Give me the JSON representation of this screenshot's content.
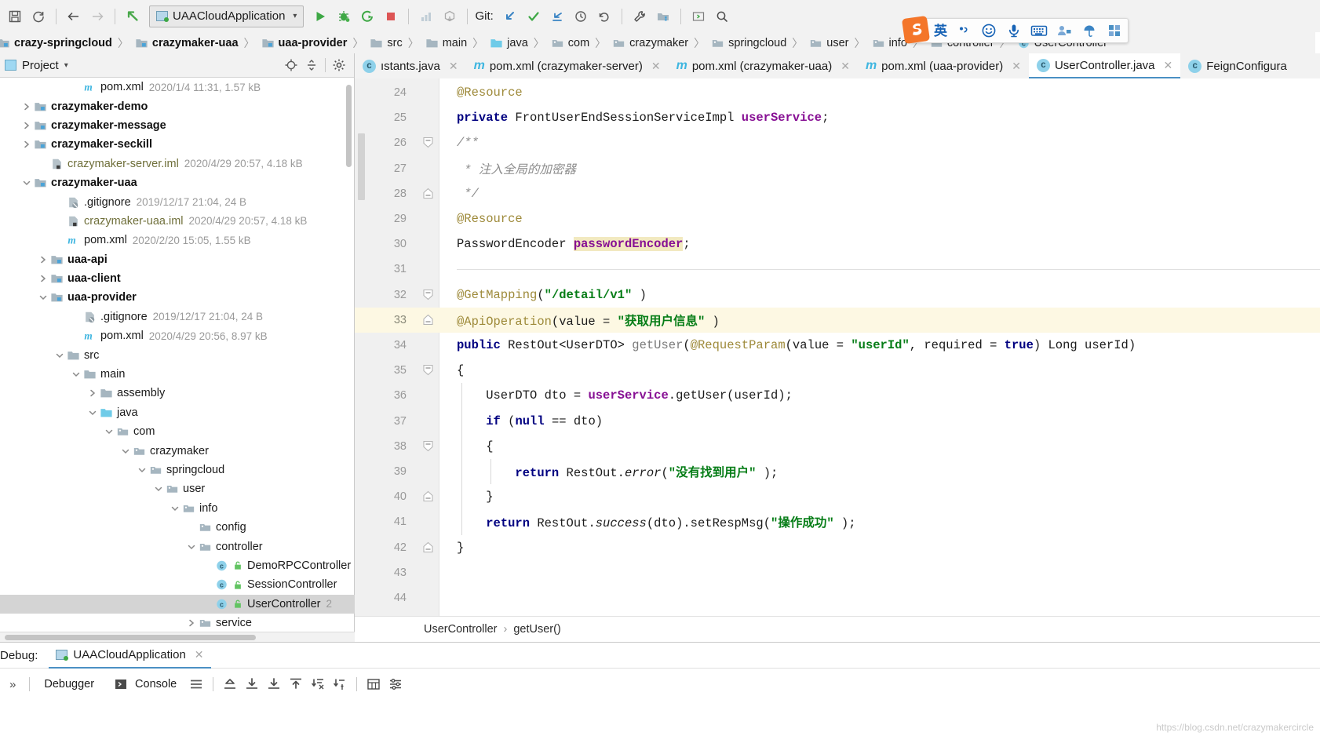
{
  "toolbar": {
    "icons": [
      {
        "name": "save-all-icon",
        "title": "Save All"
      },
      {
        "name": "sync-refresh-icon",
        "title": "Synchronize"
      },
      {
        "name": "back-arrow-icon",
        "title": "Back"
      },
      {
        "name": "forward-arrow-icon",
        "title": "Forward"
      },
      {
        "name": "jump-to-source-icon",
        "title": "Jump to source"
      }
    ],
    "run_config": {
      "label": "UAACloudApplication",
      "caret": "▾"
    },
    "run_icons": [
      {
        "name": "run-icon",
        "title": "Run"
      },
      {
        "name": "debug-icon",
        "title": "Debug"
      },
      {
        "name": "run-coverage-icon",
        "title": "Run with Coverage"
      },
      {
        "name": "stop-icon",
        "title": "Stop"
      },
      {
        "name": "profiler-icon",
        "title": "Profiler"
      },
      {
        "name": "update-app-icon",
        "title": "Update application"
      }
    ],
    "git_label": "Git:",
    "git_icons": [
      {
        "name": "git-update-project-icon",
        "title": "Update Project"
      },
      {
        "name": "git-commit-icon",
        "title": "Commit"
      },
      {
        "name": "git-push-icon",
        "title": "Push"
      },
      {
        "name": "git-history-icon",
        "title": "Show History"
      },
      {
        "name": "git-rollback-icon",
        "title": "Rollback"
      }
    ],
    "right_icons": [
      {
        "name": "settings-wrench-icon",
        "title": "Settings"
      },
      {
        "name": "project-structure-icon",
        "title": "Project Structure"
      },
      {
        "name": "terminal-icon",
        "title": "Terminal"
      },
      {
        "name": "search-everywhere-icon",
        "title": "Search Everywhere"
      }
    ]
  },
  "breadcrumb": {
    "separator": "〉",
    "items": [
      {
        "label": "crazy-springcloud",
        "icon": "module-icon",
        "bold": true
      },
      {
        "label": "crazymaker-uaa",
        "icon": "module-icon",
        "bold": true
      },
      {
        "label": "uaa-provider",
        "icon": "module-icon",
        "bold": true
      },
      {
        "label": "src",
        "icon": "folder-icon",
        "bold": false
      },
      {
        "label": "main",
        "icon": "folder-icon",
        "bold": false
      },
      {
        "label": "java",
        "icon": "source-folder-icon",
        "bold": false
      },
      {
        "label": "com",
        "icon": "package-icon",
        "bold": false
      },
      {
        "label": "crazymaker",
        "icon": "package-icon",
        "bold": false
      },
      {
        "label": "springcloud",
        "icon": "package-icon",
        "bold": false
      },
      {
        "label": "user",
        "icon": "package-icon",
        "bold": false
      },
      {
        "label": "info",
        "icon": "package-icon",
        "bold": false
      },
      {
        "label": "controller",
        "icon": "package-icon",
        "bold": false
      },
      {
        "label": "UserController",
        "icon": "class-icon",
        "bold": false
      }
    ]
  },
  "ime": {
    "logo": "S",
    "mode_label": "英",
    "items": [
      {
        "name": "sogou-logo-icon"
      },
      {
        "name": "ime-mode-english-icon"
      },
      {
        "name": "ime-punctuation-icon"
      },
      {
        "name": "ime-emoji-icon"
      },
      {
        "name": "ime-voice-icon"
      },
      {
        "name": "ime-keyboard-icon"
      },
      {
        "name": "ime-toolbox-icon"
      },
      {
        "name": "ime-umbrella-icon"
      },
      {
        "name": "ime-apps-icon"
      }
    ]
  },
  "project_panel": {
    "title": "Project",
    "title_caret": "▾",
    "actions": [
      {
        "name": "locate-target-icon",
        "title": "Select Opened File"
      },
      {
        "name": "collapse-all-icon",
        "title": "Collapse All"
      },
      {
        "name": "panel-settings-icon",
        "title": "Settings"
      }
    ],
    "tree": [
      {
        "indent": 4,
        "arrow": "none",
        "icon": "maven-pom-icon",
        "name": "pom.xml",
        "style": "plain",
        "meta": "2020/1/4 11:31, 1.57 kB"
      },
      {
        "indent": 1,
        "arrow": "right",
        "icon": "module-icon",
        "name": "crazymaker-demo",
        "style": "bold",
        "meta": ""
      },
      {
        "indent": 1,
        "arrow": "right",
        "icon": "module-icon",
        "name": "crazymaker-message",
        "style": "bold",
        "meta": ""
      },
      {
        "indent": 1,
        "arrow": "right",
        "icon": "module-icon",
        "name": "crazymaker-seckill",
        "style": "bold",
        "meta": ""
      },
      {
        "indent": 2,
        "arrow": "none",
        "icon": "iml-file-icon",
        "name": "crazymaker-server.iml",
        "style": "iml",
        "meta": "2020/4/29 20:57, 4.18 kB"
      },
      {
        "indent": 1,
        "arrow": "down",
        "icon": "module-icon",
        "name": "crazymaker-uaa",
        "style": "bold",
        "meta": ""
      },
      {
        "indent": 3,
        "arrow": "none",
        "icon": "gitignore-icon",
        "name": ".gitignore",
        "style": "plain",
        "meta": "2019/12/17 21:04, 24 B"
      },
      {
        "indent": 3,
        "arrow": "none",
        "icon": "iml-file-icon",
        "name": "crazymaker-uaa.iml",
        "style": "iml",
        "meta": "2020/4/29 20:57, 4.18 kB"
      },
      {
        "indent": 3,
        "arrow": "none",
        "icon": "maven-pom-icon",
        "name": "pom.xml",
        "style": "plain",
        "meta": "2020/2/20 15:05, 1.55 kB"
      },
      {
        "indent": 2,
        "arrow": "right",
        "icon": "module-icon",
        "name": "uaa-api",
        "style": "bold",
        "meta": ""
      },
      {
        "indent": 2,
        "arrow": "right",
        "icon": "module-icon",
        "name": "uaa-client",
        "style": "bold",
        "meta": ""
      },
      {
        "indent": 2,
        "arrow": "down",
        "icon": "module-icon",
        "name": "uaa-provider",
        "style": "bold",
        "meta": ""
      },
      {
        "indent": 4,
        "arrow": "none",
        "icon": "gitignore-icon",
        "name": ".gitignore",
        "style": "plain",
        "meta": "2019/12/17 21:04, 24 B"
      },
      {
        "indent": 4,
        "arrow": "none",
        "icon": "maven-pom-icon",
        "name": "pom.xml",
        "style": "plain",
        "meta": "2020/4/29 20:56, 8.97 kB"
      },
      {
        "indent": 3,
        "arrow": "down",
        "icon": "folder-icon",
        "name": "src",
        "style": "plain",
        "meta": ""
      },
      {
        "indent": 4,
        "arrow": "down",
        "icon": "folder-icon",
        "name": "main",
        "style": "plain",
        "meta": ""
      },
      {
        "indent": 5,
        "arrow": "right",
        "icon": "folder-icon",
        "name": "assembly",
        "style": "plain",
        "meta": ""
      },
      {
        "indent": 5,
        "arrow": "down",
        "icon": "source-folder-icon",
        "name": "java",
        "style": "plain",
        "meta": ""
      },
      {
        "indent": 6,
        "arrow": "down",
        "icon": "package-icon",
        "name": "com",
        "style": "plain",
        "meta": ""
      },
      {
        "indent": 7,
        "arrow": "down",
        "icon": "package-icon",
        "name": "crazymaker",
        "style": "plain",
        "meta": ""
      },
      {
        "indent": 8,
        "arrow": "down",
        "icon": "package-icon",
        "name": "springcloud",
        "style": "plain",
        "meta": ""
      },
      {
        "indent": 9,
        "arrow": "down",
        "icon": "package-icon",
        "name": "user",
        "style": "plain",
        "meta": ""
      },
      {
        "indent": 10,
        "arrow": "down",
        "icon": "package-icon",
        "name": "info",
        "style": "plain",
        "meta": ""
      },
      {
        "indent": 11,
        "arrow": "none",
        "icon": "package-icon",
        "name": "config",
        "style": "plain",
        "meta": ""
      },
      {
        "indent": 11,
        "arrow": "down",
        "icon": "package-icon",
        "name": "controller",
        "style": "plain",
        "meta": ""
      },
      {
        "indent": 12,
        "arrow": "none",
        "icon": "java-class-icon",
        "name": "DemoRPCController",
        "style": "plain",
        "meta": ""
      },
      {
        "indent": 12,
        "arrow": "none",
        "icon": "java-class-icon",
        "name": "SessionController",
        "style": "plain",
        "meta": ""
      },
      {
        "indent": 12,
        "arrow": "none",
        "icon": "java-class-icon",
        "name": "UserController",
        "style": "plain",
        "meta": "2",
        "selected": true
      },
      {
        "indent": 11,
        "arrow": "right",
        "icon": "package-icon",
        "name": "service",
        "style": "plain",
        "meta": ""
      }
    ]
  },
  "editor": {
    "tabs": [
      {
        "label": "ıstants.java",
        "icon": "java-class-icon",
        "active": false,
        "closable": true,
        "truncated": true
      },
      {
        "label": "pom.xml (crazymaker-server)",
        "icon": "maven-pom-icon",
        "active": false,
        "closable": true
      },
      {
        "label": "pom.xml (crazymaker-uaa)",
        "icon": "maven-pom-icon",
        "active": false,
        "closable": true
      },
      {
        "label": "pom.xml (uaa-provider)",
        "icon": "maven-pom-icon",
        "active": false,
        "closable": true
      },
      {
        "label": "UserController.java",
        "icon": "java-class-icon",
        "active": true,
        "closable": true
      },
      {
        "label": "FeignConfigura",
        "icon": "java-class-icon",
        "active": false,
        "closable": false,
        "truncated": true
      }
    ],
    "first_line": 24,
    "lines": [
      {
        "n": 24,
        "fold": "none",
        "highlight": false,
        "tokens": [
          {
            "t": "@Resource",
            "c": "ann"
          }
        ],
        "indent": 0
      },
      {
        "n": 25,
        "fold": "none",
        "highlight": false,
        "tokens": [
          {
            "t": "private ",
            "c": "kw"
          },
          {
            "t": "FrontUserEndSessionServiceImpl ",
            "c": "pln"
          },
          {
            "t": "userService",
            "c": "fld"
          },
          {
            "t": ";",
            "c": "pln"
          }
        ],
        "indent": 0
      },
      {
        "n": 26,
        "fold": "start",
        "highlight": false,
        "tokens": [
          {
            "t": "/**",
            "c": "cmt"
          }
        ],
        "indent": 0
      },
      {
        "n": 27,
        "fold": "none",
        "highlight": false,
        "tokens": [
          {
            "t": " * 注入全局的加密器",
            "c": "cmt"
          }
        ],
        "indent": 0
      },
      {
        "n": 28,
        "fold": "end",
        "highlight": false,
        "tokens": [
          {
            "t": " */",
            "c": "cmt"
          }
        ],
        "indent": 0
      },
      {
        "n": 29,
        "fold": "none",
        "highlight": false,
        "tokens": [
          {
            "t": "@Resource",
            "c": "ann"
          }
        ],
        "indent": 0
      },
      {
        "n": 30,
        "fold": "none",
        "highlight": false,
        "tokens": [
          {
            "t": "PasswordEncoder ",
            "c": "pln"
          },
          {
            "t": "passwordEncoder",
            "c": "hlvar"
          },
          {
            "t": ";",
            "c": "pln"
          }
        ],
        "indent": 0
      },
      {
        "n": 31,
        "fold": "none",
        "highlight": false,
        "separator": true,
        "tokens": [],
        "indent": 0
      },
      {
        "n": 32,
        "fold": "start",
        "highlight": false,
        "tokens": [
          {
            "t": "@GetMapping",
            "c": "ann"
          },
          {
            "t": "(",
            "c": "pln"
          },
          {
            "t": "\"/detail/v1\"",
            "c": "str"
          },
          {
            "t": " )",
            "c": "pln"
          }
        ],
        "indent": 0
      },
      {
        "n": 33,
        "fold": "end",
        "highlight": true,
        "tokens": [
          {
            "t": "@ApiOperation",
            "c": "ann"
          },
          {
            "t": "(value = ",
            "c": "pln"
          },
          {
            "t": "\"获取用户信息\"",
            "c": "str"
          },
          {
            "t": " )",
            "c": "pln"
          }
        ],
        "indent": 0
      },
      {
        "n": 34,
        "fold": "none",
        "highlight": false,
        "tokens": [
          {
            "t": "public ",
            "c": "kw"
          },
          {
            "t": "RestOut<UserDTO> ",
            "c": "pln"
          },
          {
            "t": "getUser",
            "c": "mtd"
          },
          {
            "t": "(",
            "c": "pln"
          },
          {
            "t": "@RequestParam",
            "c": "ann"
          },
          {
            "t": "(value = ",
            "c": "pln"
          },
          {
            "t": "\"userId\"",
            "c": "str"
          },
          {
            "t": ", required = ",
            "c": "pln"
          },
          {
            "t": "true",
            "c": "kw"
          },
          {
            "t": ") Long userId)",
            "c": "pln"
          }
        ],
        "indent": 0
      },
      {
        "n": 35,
        "fold": "start",
        "highlight": false,
        "tokens": [
          {
            "t": "{",
            "c": "pln"
          }
        ],
        "indent": 0
      },
      {
        "n": 36,
        "fold": "none",
        "highlight": false,
        "tokens": [
          {
            "t": "    UserDTO dto = ",
            "c": "pln"
          },
          {
            "t": "userService",
            "c": "fld"
          },
          {
            "t": ".getUser(userId);",
            "c": "pln"
          }
        ],
        "indent": 1
      },
      {
        "n": 37,
        "fold": "none",
        "highlight": false,
        "tokens": [
          {
            "t": "    ",
            "c": "pln"
          },
          {
            "t": "if",
            "c": "kw"
          },
          {
            "t": " (",
            "c": "pln"
          },
          {
            "t": "null",
            "c": "kw"
          },
          {
            "t": " == dto)",
            "c": "pln"
          }
        ],
        "indent": 1
      },
      {
        "n": 38,
        "fold": "start",
        "highlight": false,
        "tokens": [
          {
            "t": "    {",
            "c": "pln"
          }
        ],
        "indent": 1
      },
      {
        "n": 39,
        "fold": "none",
        "highlight": false,
        "tokens": [
          {
            "t": "        ",
            "c": "pln"
          },
          {
            "t": "return",
            "c": "kw"
          },
          {
            "t": " RestOut.",
            "c": "pln"
          },
          {
            "t": "error",
            "c": "mtdi"
          },
          {
            "t": "(",
            "c": "pln"
          },
          {
            "t": "\"没有找到用户\"",
            "c": "str"
          },
          {
            "t": " );",
            "c": "pln"
          }
        ],
        "indent": 2
      },
      {
        "n": 40,
        "fold": "end",
        "highlight": false,
        "tokens": [
          {
            "t": "    }",
            "c": "pln"
          }
        ],
        "indent": 1
      },
      {
        "n": 41,
        "fold": "none",
        "highlight": false,
        "tokens": [
          {
            "t": "    ",
            "c": "pln"
          },
          {
            "t": "return",
            "c": "kw"
          },
          {
            "t": " RestOut.",
            "c": "pln"
          },
          {
            "t": "success",
            "c": "mtdi"
          },
          {
            "t": "(dto).setRespMsg(",
            "c": "pln"
          },
          {
            "t": "\"操作成功\"",
            "c": "str"
          },
          {
            "t": " );",
            "c": "pln"
          }
        ],
        "indent": 1
      },
      {
        "n": 42,
        "fold": "end",
        "highlight": false,
        "tokens": [
          {
            "t": "}",
            "c": "pln"
          }
        ],
        "indent": 0
      },
      {
        "n": 43,
        "fold": "none",
        "highlight": false,
        "tokens": [],
        "indent": 0
      },
      {
        "n": 44,
        "fold": "none",
        "highlight": false,
        "tokens": [],
        "indent": 0
      }
    ],
    "footer_breadcrumb": [
      "UserController",
      "getUser()"
    ],
    "footer_separator": "›"
  },
  "debug": {
    "label": "Debug:",
    "tab_label": "UAACloudApplication",
    "expand_toggle": "»",
    "buttons": [
      {
        "name": "debugger-tab",
        "label": "Debugger",
        "icon": ""
      },
      {
        "name": "console-tab",
        "label": "Console",
        "icon": "console-icon"
      }
    ],
    "toolbar_icons": [
      {
        "name": "layout-settings-icon"
      },
      {
        "name": "step-out-icon"
      },
      {
        "name": "step-over-icon"
      },
      {
        "name": "step-into-icon"
      },
      {
        "name": "force-step-into-icon"
      },
      {
        "name": "smart-step-into-icon"
      },
      {
        "name": "run-to-cursor-icon"
      },
      {
        "name": "evaluate-expression-icon"
      },
      {
        "name": "settings-lines-icon"
      }
    ]
  },
  "watermark": "https://blog.csdn.net/crazymakercircle",
  "colors": {
    "accent_blue": "#4a90c4",
    "toolbar_bg": "#f2f2f2",
    "selection_gray": "#d4d4d4",
    "highlight_line": "#fdf8e3",
    "string_green": "#067d17",
    "keyword_navy": "#000080",
    "annotation_gold": "#9e8a3a",
    "field_purple": "#871094",
    "run_green": "#3ea845",
    "stop_red": "#dd5555",
    "sogou_orange": "#f4762a",
    "ime_blue": "#1763b6"
  }
}
